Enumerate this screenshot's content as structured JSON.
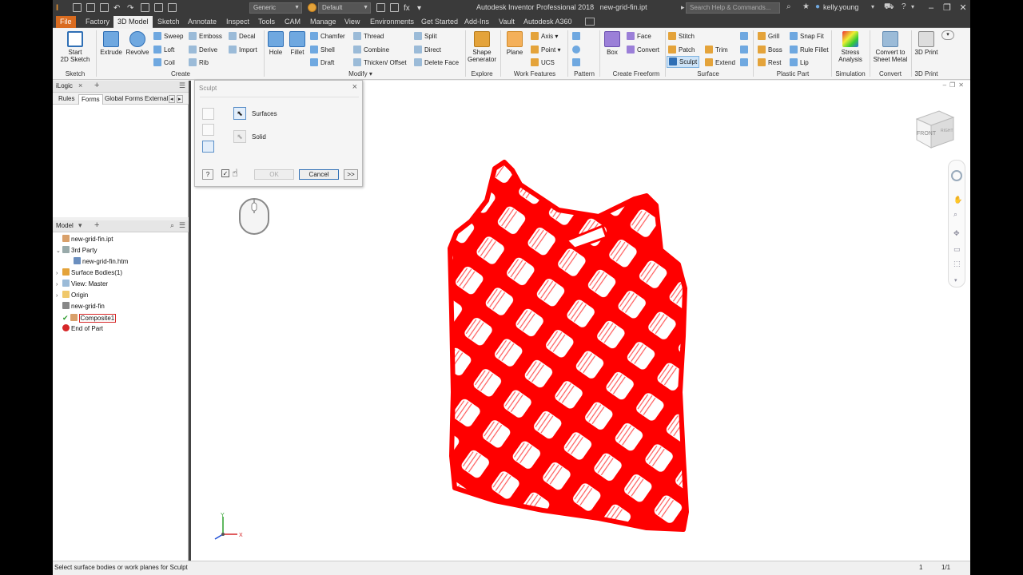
{
  "app": {
    "title": "Autodesk Inventor Professional 2018",
    "document": "new-grid-fin.ipt",
    "search_placeholder": "Search Help & Commands...",
    "user": "kelly.young",
    "material": "Generic",
    "appearance": "Default"
  },
  "menu_tabs": [
    "File",
    "Factory",
    "3D Model",
    "Sketch",
    "Annotate",
    "Inspect",
    "Tools",
    "CAM",
    "Manage",
    "View",
    "Environments",
    "Get Started",
    "Add-Ins",
    "Vault",
    "Autodesk A360"
  ],
  "active_tab": "3D Model",
  "ribbon": {
    "sketch": {
      "start": "Start",
      "start2": "2D Sketch",
      "group": "Sketch"
    },
    "create": {
      "extrude": "Extrude",
      "revolve": "Revolve",
      "sweep": "Sweep",
      "loft": "Loft",
      "coil": "Coil",
      "emboss": "Emboss",
      "derive": "Derive",
      "rib": "Rib",
      "decal": "Decal",
      "import": "Import",
      "group": "Create"
    },
    "modify": {
      "hole": "Hole",
      "fillet": "Fillet",
      "chamfer": "Chamfer",
      "shell": "Shell",
      "draft": "Draft",
      "thread": "Thread",
      "combine": "Combine",
      "thicken": "Thicken/ Offset",
      "split": "Split",
      "direct": "Direct",
      "delete_face": "Delete Face",
      "group": "Modify"
    },
    "explore": {
      "shape1": "Shape",
      "shape2": "Generator",
      "group": "Explore"
    },
    "work": {
      "plane": "Plane",
      "axis": "Axis",
      "point": "Point",
      "ucs": "UCS",
      "group": "Work Features"
    },
    "pattern": {
      "group": "Pattern"
    },
    "freeform": {
      "box": "Box",
      "face": "Face",
      "convert": "Convert",
      "group": "Create Freeform"
    },
    "surface": {
      "stitch": "Stitch",
      "patch": "Patch",
      "sculpt": "Sculpt",
      "trim": "Trim",
      "extend": "Extend",
      "group": "Surface"
    },
    "plastic": {
      "grill": "Grill",
      "boss": "Boss",
      "rest": "Rest",
      "snap_fit": "Snap Fit",
      "rule_fillet": "Rule Fillet",
      "lip": "Lip",
      "group": "Plastic Part"
    },
    "simulation": {
      "stress1": "Stress",
      "stress2": "Analysis",
      "group": "Simulation"
    },
    "convert": {
      "c1": "Convert to",
      "c2": "Sheet Metal",
      "group": "Convert"
    },
    "print": {
      "label": "3D Print",
      "group": "3D Print"
    }
  },
  "ilogic": {
    "title": "iLogic",
    "tabs": [
      "Rules",
      "Forms",
      "Global Forms",
      "External"
    ],
    "active": "Forms"
  },
  "model": {
    "title": "Model",
    "tree": [
      {
        "label": "new-grid-fin.ipt",
        "level": 0,
        "icon": "part-icon",
        "twisty": ""
      },
      {
        "label": "3rd Party",
        "level": 0,
        "icon": "folder-3rd-party-icon",
        "twisty": "v"
      },
      {
        "label": "new-grid-fin.htm",
        "level": 1,
        "icon": "document-icon",
        "twisty": ""
      },
      {
        "label": "Surface Bodies(1)",
        "level": 0,
        "icon": "surface-bodies-icon",
        "twisty": ">"
      },
      {
        "label": "View: Master",
        "level": 0,
        "icon": "view-icon",
        "twisty": ">"
      },
      {
        "label": "Origin",
        "level": 0,
        "icon": "folder-icon",
        "twisty": ">"
      },
      {
        "label": "new-grid-fin",
        "level": 0,
        "icon": "mesh-icon",
        "twisty": ""
      },
      {
        "label": "Composite1",
        "level": 0,
        "icon": "composite-icon",
        "twisty": ""
      },
      {
        "label": "End of Part",
        "level": 0,
        "icon": "end-of-part-icon",
        "twisty": ""
      }
    ]
  },
  "dialog": {
    "title": "Sculpt",
    "surfaces": "Surfaces",
    "solid": "Solid",
    "ok": "OK",
    "cancel": "Cancel",
    "more": ">>"
  },
  "viewcube": {
    "front": "FRONT",
    "right": "RIGHT"
  },
  "triad": {
    "x": "X",
    "y": "Y"
  },
  "status": {
    "message": "Select surface bodies or work planes for Sculpt",
    "count": "1",
    "page": "1/1"
  },
  "colors": {
    "model_red": "#ff0000",
    "file_tab": "#d96b1f",
    "ribbon_blue": "#2f6fb5"
  }
}
